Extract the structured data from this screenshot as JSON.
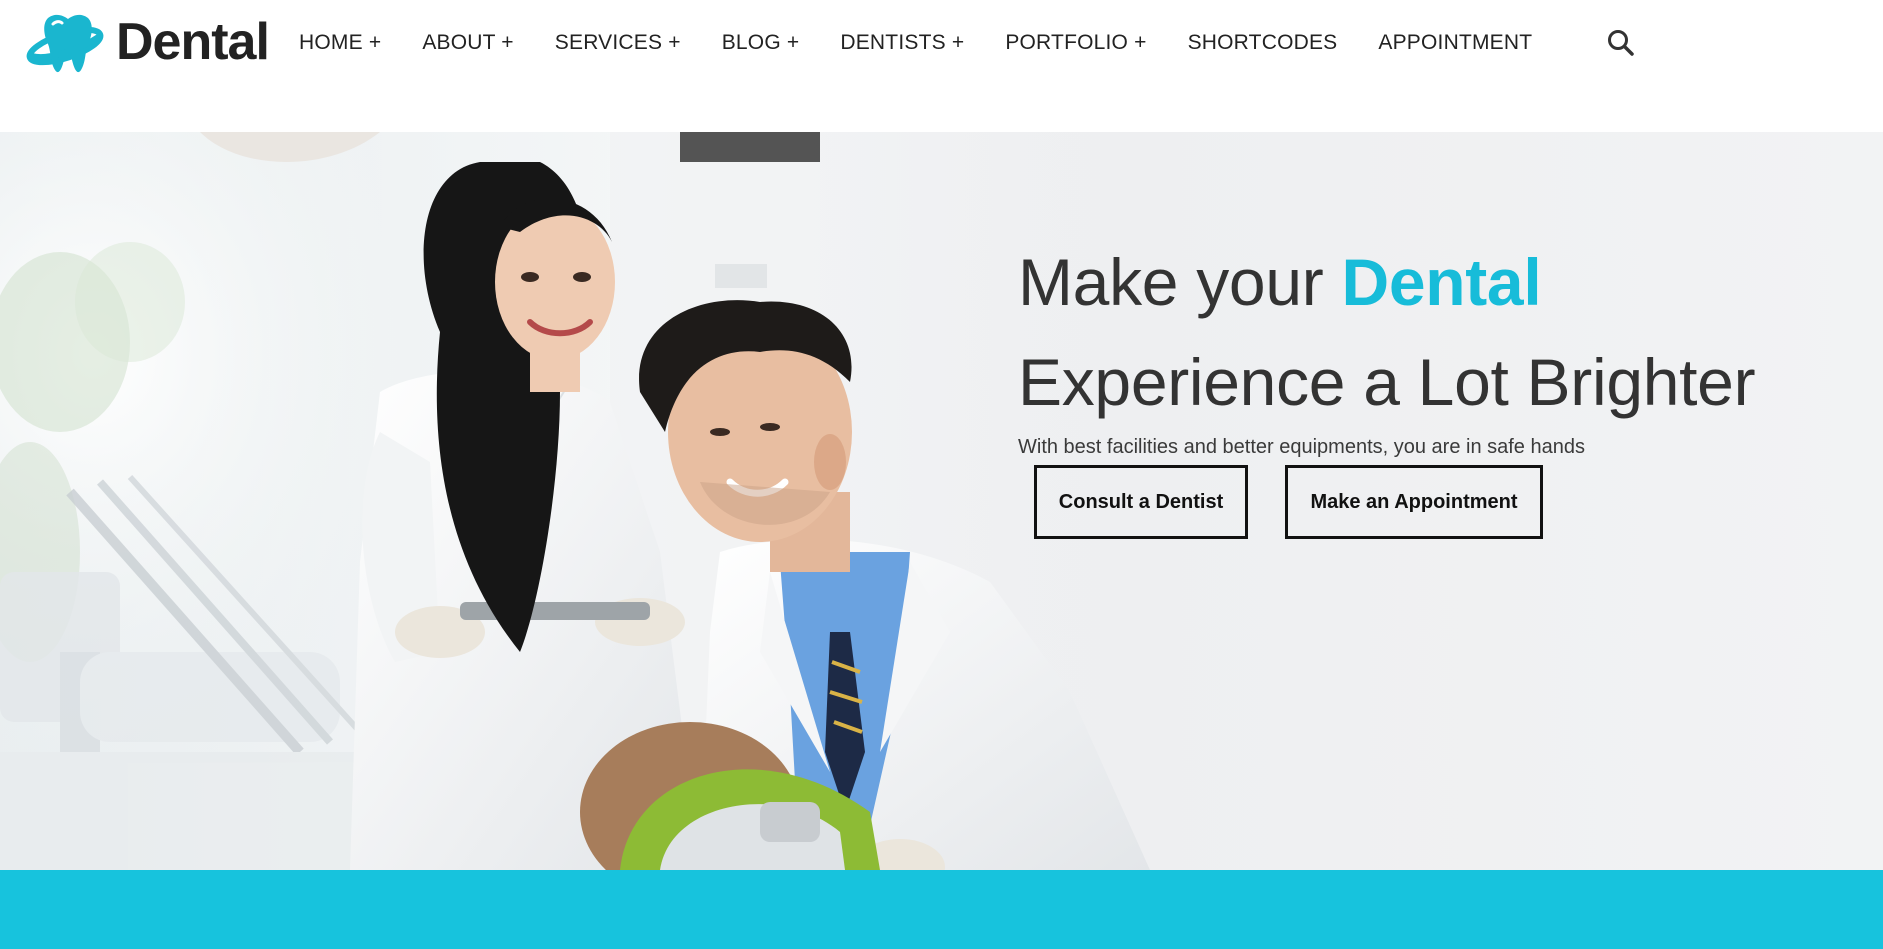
{
  "brand": {
    "name": "Dental",
    "logo_icon": "tooth-logo-icon",
    "accent_color": "#17bcd9"
  },
  "nav": {
    "items": [
      {
        "label": "HOME +"
      },
      {
        "label": "ABOUT +"
      },
      {
        "label": "SERVICES +"
      },
      {
        "label": "BLOG +"
      },
      {
        "label": "DENTISTS +"
      },
      {
        "label": "PORTFOLIO +"
      },
      {
        "label": "SHORTCODES"
      },
      {
        "label": "APPOINTMENT"
      }
    ],
    "search_icon": "search-icon"
  },
  "hero": {
    "title_part1": "Make your ",
    "title_accent": "Dental",
    "title_line2": "Experience a Lot Brighter",
    "subtitle": "With best facilities and better equipments, you are in safe hands",
    "buttons": {
      "consult": "Consult a Dentist",
      "appointment": "Make an Appointment"
    },
    "photo": "dentist-team-photo"
  },
  "footer_band": {
    "color": "#17c3dd"
  }
}
